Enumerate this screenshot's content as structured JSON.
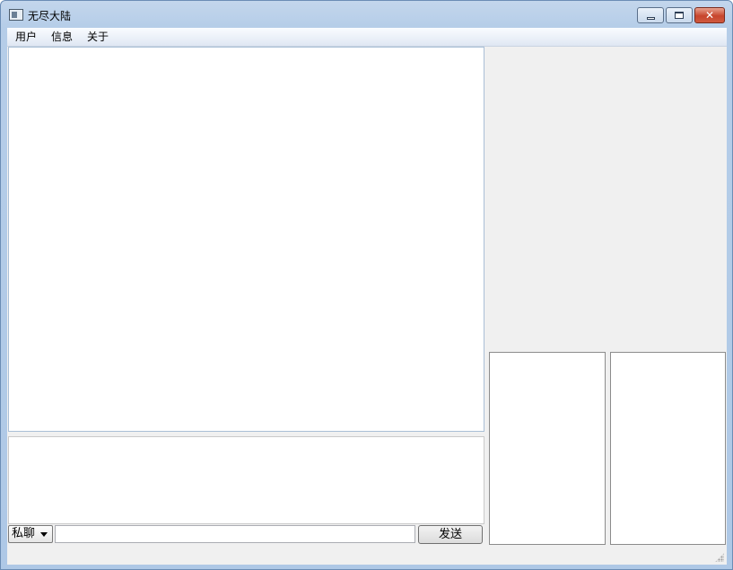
{
  "window": {
    "title": "无尽大陆",
    "minimize_icon": "minimize-icon",
    "maximize_icon": "maximize-icon",
    "close_icon": "close-icon",
    "close_glyph": "✕"
  },
  "menu": {
    "items": [
      {
        "label": "用户"
      },
      {
        "label": "信息"
      },
      {
        "label": "关于"
      }
    ]
  },
  "bottom_bar": {
    "chat_mode": "私聊",
    "message_value": "",
    "send_label": "发送"
  },
  "colors": {
    "frame": "#b5cde8",
    "close_button": "#c7452d",
    "client_background": "#f0f0f0"
  }
}
